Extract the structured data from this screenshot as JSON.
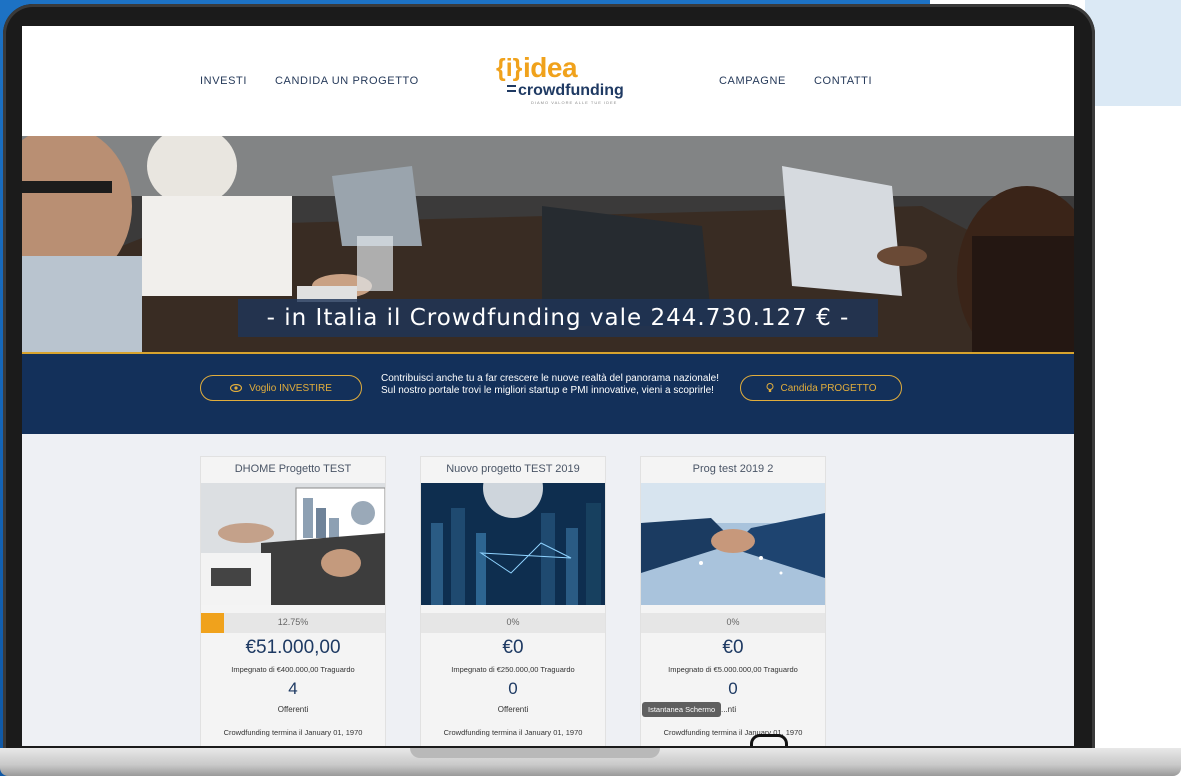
{
  "nav": {
    "investi": "INVESTI",
    "candida": "CANDIDA UN PROGETTO",
    "campagne": "CAMPAGNE",
    "contatti": "CONTATTI"
  },
  "logo": {
    "brace": "{i}",
    "word": "idea",
    "sub": "crowdfunding",
    "tagline": "DIAMO VALORE ALLE TUE IDEE"
  },
  "hero": {
    "banner": "- in Italia il Crowdfunding vale 244.730.127 € -"
  },
  "band": {
    "invest_button": "Voglio INVESTIRE",
    "text": "Contribuisci anche tu a far crescere le nuove realtà del panorama nazionale! Sul nostro portale trovi le migliori startup e PMI innovative, vieni a scoprirle!",
    "candidate_button": "Candida PROGETTO"
  },
  "cards": [
    {
      "title": "DHOME Progetto TEST",
      "progress_label": "12.75%",
      "progress": 0.1275,
      "amount": "€51.000,00",
      "pledged": "Impegnato di €400.000,00 Traguardo",
      "count": "4",
      "offer_label": "Offerenti",
      "end": "Crowdfunding termina il January 01, 1970"
    },
    {
      "title": "Nuovo progetto TEST 2019",
      "progress_label": "0%",
      "progress": 0,
      "amount": "€0",
      "pledged": "Impegnato di €250.000,00 Traguardo",
      "count": "0",
      "offer_label": "Offerenti",
      "end": "Crowdfunding termina il January 01, 1970"
    },
    {
      "title": "Prog test 2019 2",
      "progress_label": "0%",
      "progress": 0,
      "amount": "€0",
      "pledged": "Impegnato di €5.000.000,00 Traguardo",
      "count": "0",
      "offer_label": "...nti",
      "end": "Crowdfunding termina il January 01, 1970"
    }
  ],
  "tooltip": "Istantanea Schermo",
  "colors": {
    "navy": "#13305a",
    "gold": "#e1ad3c",
    "orange": "#f0a21c"
  }
}
